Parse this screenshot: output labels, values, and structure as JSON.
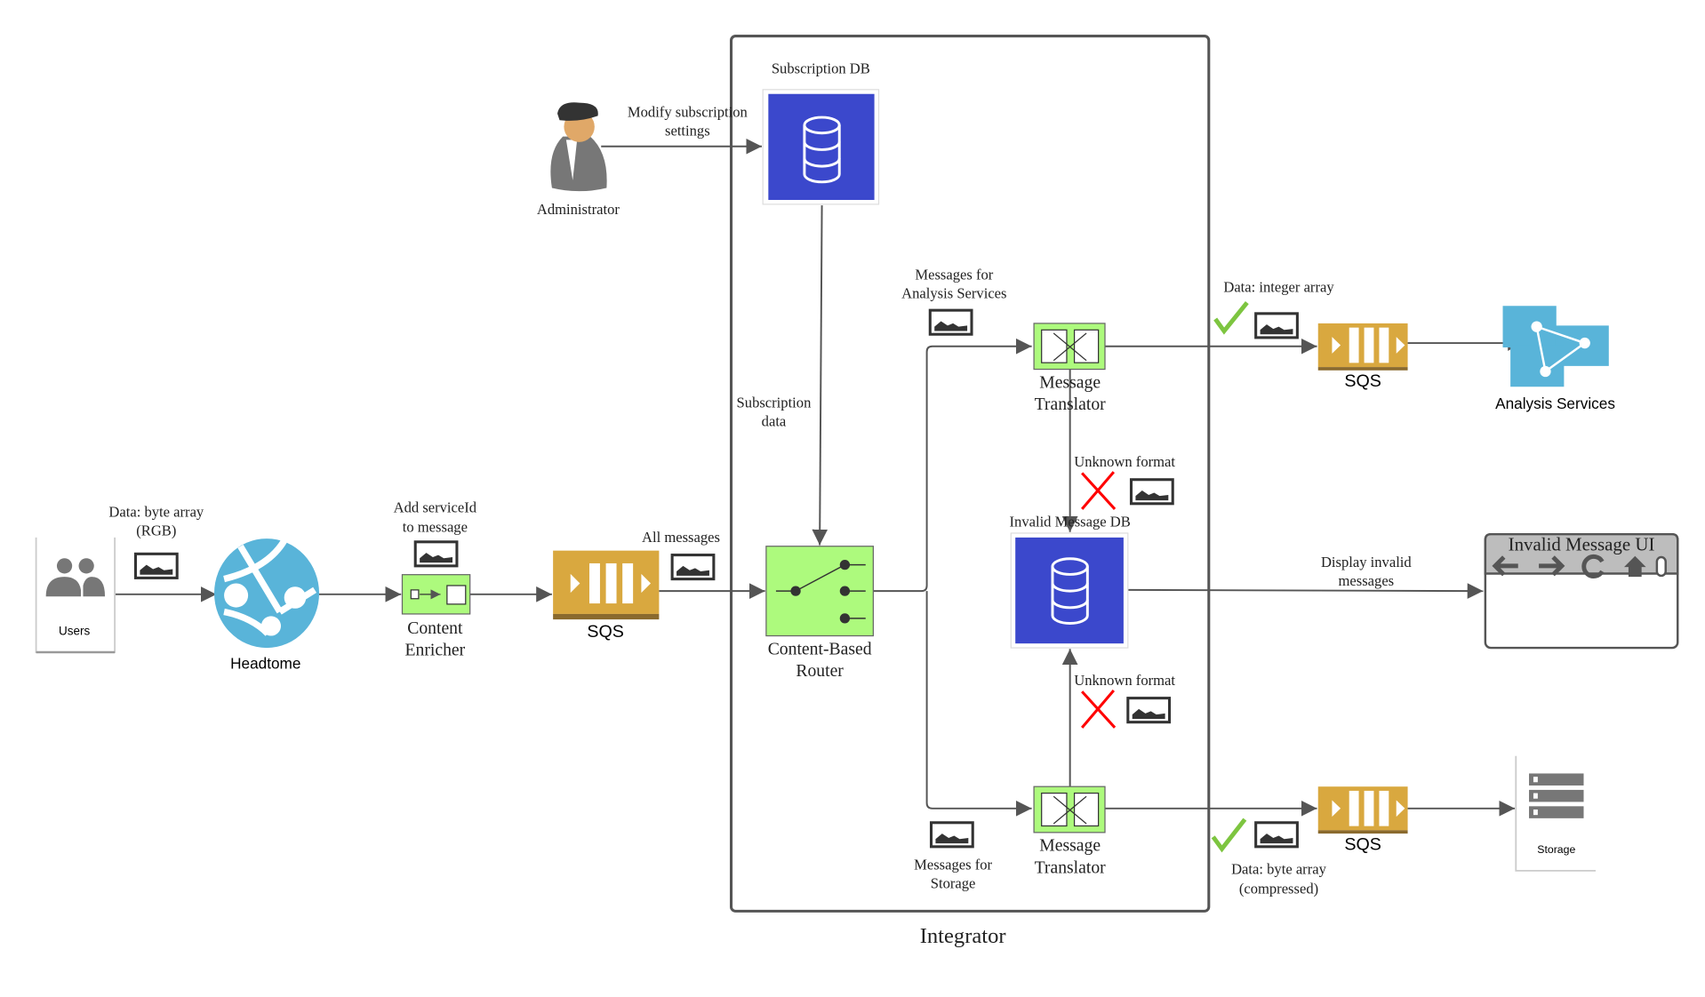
{
  "container": {
    "label": "Integrator"
  },
  "nodes": {
    "users": {
      "label": "Users"
    },
    "headtome": {
      "label": "Headtome"
    },
    "enricher": {
      "line1": "Content",
      "line2": "Enricher"
    },
    "sqs_in": {
      "label": "SQS"
    },
    "administrator": {
      "label": "Administrator"
    },
    "subscription_db": {
      "label": "Subscription DB"
    },
    "router": {
      "line1": "Content-Based",
      "line2": "Router"
    },
    "translator_top": {
      "line1": "Message",
      "line2": "Translator"
    },
    "translator_bottom": {
      "line1": "Message",
      "line2": "Translator"
    },
    "invalid_db": {
      "label": "Invalid Message DB"
    },
    "sqs_analysis": {
      "label": "SQS"
    },
    "sqs_storage": {
      "label": "SQS"
    },
    "analysis_services": {
      "label": "Analysis Services"
    },
    "storage": {
      "label": "Storage"
    },
    "invalid_ui": {
      "title": "Invalid Message UI"
    }
  },
  "edges": {
    "users_headtome": {
      "line1": "Data: byte array",
      "line2": "(RGB)"
    },
    "enricher": {
      "line1": "Add serviceId",
      "line2": "to message"
    },
    "sqs_router": {
      "label": "All messages"
    },
    "admin_db": {
      "line1": "Modify subscription",
      "line2": "settings"
    },
    "db_router": {
      "line1": "Subscription",
      "line2": "data"
    },
    "to_analysis": {
      "line1": "Messages for",
      "line2": "Analysis Services"
    },
    "to_storage": {
      "line1": "Messages for",
      "line2": "Storage"
    },
    "unknown_top": {
      "label": "Unknown format"
    },
    "unknown_bottom": {
      "label": "Unknown format"
    },
    "analysis_out": {
      "label": "Data: integer array"
    },
    "storage_out": {
      "line1": "Data: byte array",
      "line2": "(compressed)"
    },
    "display_invalid": {
      "line1": "Display invalid",
      "line2": "messages"
    }
  },
  "colors": {
    "db_blue": "#3b48cc",
    "eip_green": "#adfa7d",
    "sqs_gold": "#d9a83f",
    "azure_blue": "#59b4d9",
    "reject_red": "#ff0000",
    "accept_green": "#7dc540"
  }
}
